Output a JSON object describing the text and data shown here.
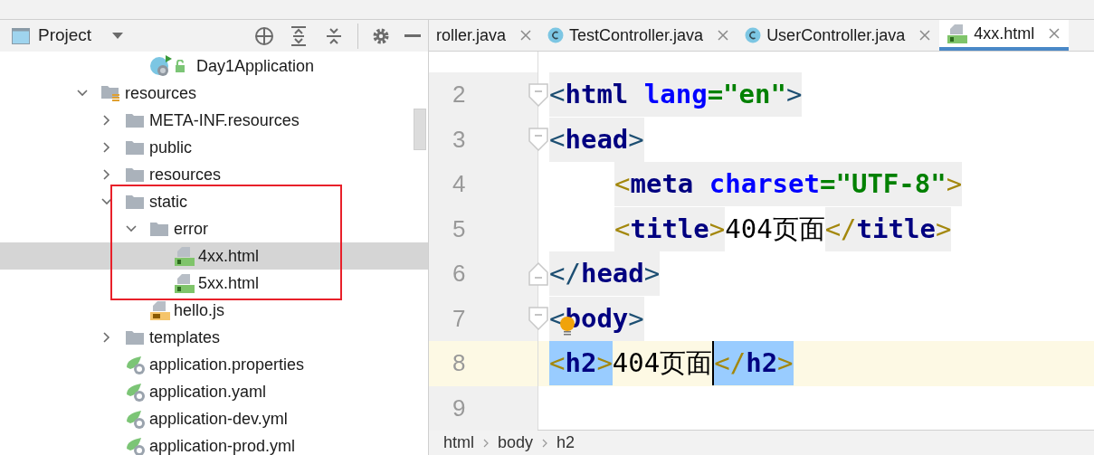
{
  "project_panel": {
    "title": "Project"
  },
  "tree": {
    "above": [
      {
        "label": "Day1Application",
        "kind": "class-run",
        "locked": true
      }
    ],
    "items": [
      {
        "label": "resources",
        "kind": "resources-folder",
        "expanded": true,
        "selected": false,
        "children": [
          {
            "label": "META-INF.resources",
            "kind": "folder",
            "expanded": false,
            "selected": false
          },
          {
            "label": "public",
            "kind": "folder",
            "expanded": false,
            "selected": false
          },
          {
            "label": "resources",
            "kind": "folder",
            "expanded": false,
            "selected": false
          },
          {
            "label": "static",
            "kind": "folder",
            "expanded": true,
            "selected": false,
            "children": [
              {
                "label": "error",
                "kind": "folder",
                "expanded": true,
                "selected": false,
                "children": [
                  {
                    "label": "4xx.html",
                    "kind": "html",
                    "selected": true
                  },
                  {
                    "label": "5xx.html",
                    "kind": "html",
                    "selected": false
                  }
                ]
              },
              {
                "label": "hello.js",
                "kind": "js",
                "selected": false
              }
            ]
          },
          {
            "label": "templates",
            "kind": "folder",
            "expanded": false,
            "selected": false
          },
          {
            "label": "application.properties",
            "kind": "spring",
            "selected": false
          },
          {
            "label": "application.yaml",
            "kind": "spring",
            "selected": false
          },
          {
            "label": "application-dev.yml",
            "kind": "spring",
            "selected": false
          },
          {
            "label": "application-prod.yml",
            "kind": "spring",
            "selected": false
          }
        ]
      }
    ]
  },
  "tabs": [
    {
      "label": "roller.java",
      "kind": "plain",
      "selected": false
    },
    {
      "label": "TestController.java",
      "kind": "class",
      "selected": false
    },
    {
      "label": "UserController.java",
      "kind": "class",
      "selected": false
    },
    {
      "label": "4xx.html",
      "kind": "html",
      "selected": true
    }
  ],
  "editor": {
    "lines": [
      {
        "number": "2",
        "fold_start": true,
        "fold_end": false,
        "current": false,
        "segments": [
          {
            "text": "<",
            "kind": "bracket-dark"
          },
          {
            "text": "html",
            "kind": "tag"
          },
          {
            "text": " lang",
            "kind": "attr"
          },
          {
            "text": "=\"en\"",
            "kind": "value"
          },
          {
            "text": ">",
            "kind": "bracket-dark"
          }
        ]
      },
      {
        "number": "3",
        "fold_start": true,
        "fold_end": false,
        "current": false,
        "segments": [
          {
            "text": "<",
            "kind": "bracket-dark"
          },
          {
            "text": "head",
            "kind": "tag"
          },
          {
            "text": ">",
            "kind": "bracket-dark"
          }
        ],
        "children": [
          {
            "number": "4",
            "fold_start": false,
            "fold_end": false,
            "current": false,
            "segments": [
              {
                "text": "<",
                "kind": "bracket"
              },
              {
                "text": "meta",
                "kind": "tag"
              },
              {
                "text": " charset",
                "kind": "attr"
              },
              {
                "text": "=\"UTF-8\"",
                "kind": "value"
              },
              {
                "text": ">",
                "kind": "bracket"
              }
            ]
          },
          {
            "number": "5",
            "fold_start": false,
            "fold_end": false,
            "current": false,
            "segments": [
              {
                "text": "<",
                "kind": "bracket"
              },
              {
                "text": "title",
                "kind": "tag"
              },
              {
                "text": ">",
                "kind": "bracket"
              },
              {
                "text": "404页面",
                "kind": "text"
              },
              {
                "text": "</",
                "kind": "bracket"
              },
              {
                "text": "title",
                "kind": "tag"
              },
              {
                "text": ">",
                "kind": "bracket"
              }
            ]
          }
        ]
      },
      {
        "number": "6",
        "fold_start": false,
        "fold_end": true,
        "current": false,
        "segments": [
          {
            "text": "</",
            "kind": "bracket-dark"
          },
          {
            "text": "head",
            "kind": "tag"
          },
          {
            "text": ">",
            "kind": "bracket-dark"
          }
        ]
      },
      {
        "number": "7",
        "fold_start": true,
        "fold_end": false,
        "current": false,
        "segments": [
          {
            "text": "<",
            "kind": "bracket-dark"
          },
          {
            "text": "body",
            "kind": "tag"
          },
          {
            "text": ">",
            "kind": "bracket-dark"
          }
        ]
      },
      {
        "number": "8",
        "fold_start": false,
        "fold_end": false,
        "current": true,
        "segments": [
          {
            "text": "<",
            "kind": "bracket",
            "matched": true
          },
          {
            "text": "h2",
            "kind": "tag",
            "matched": true
          },
          {
            "text": ">",
            "kind": "bracket",
            "matched": true
          },
          {
            "text": "404页面",
            "kind": "text",
            "caret": true
          },
          {
            "text": "</",
            "kind": "bracket",
            "matched": true
          },
          {
            "text": "h2",
            "kind": "tag",
            "matched": true
          },
          {
            "text": ">",
            "kind": "bracket",
            "matched": true
          }
        ]
      },
      {
        "number": "9",
        "fold_start": false,
        "fold_end": false,
        "current": false
      }
    ]
  },
  "breadcrumbs": [
    "html",
    "body",
    "h2"
  ]
}
